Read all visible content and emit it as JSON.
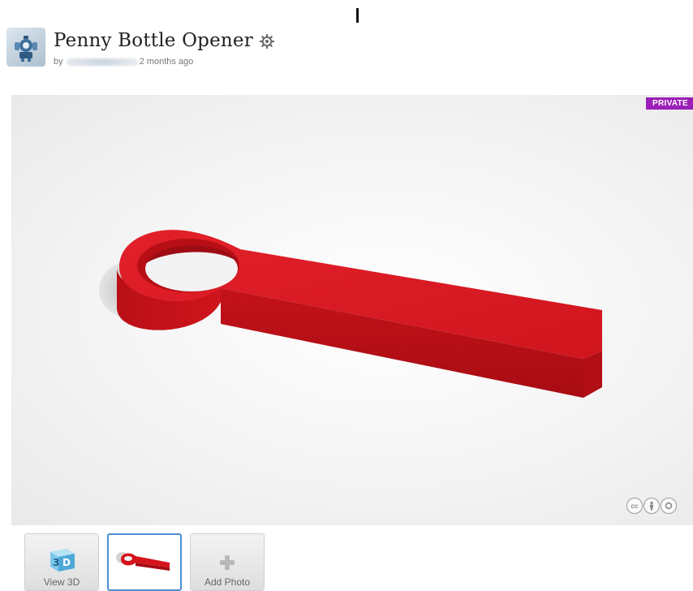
{
  "header": {
    "title": "Penny Bottle Opener",
    "by_prefix": "by",
    "time_ago": "2 months ago"
  },
  "icons": {
    "avatar": "robot-avatar-icon",
    "settings": "gear-icon",
    "license": [
      "creative-commons-icon",
      "attribution-icon",
      "no-derivatives-icon"
    ],
    "view3d": "3d-cube-icon",
    "add_photo": "plus-icon"
  },
  "viewer": {
    "badge": "PRIVATE",
    "license_labels": [
      "cc",
      "",
      ""
    ]
  },
  "thumbnails": [
    {
      "label": "View 3D"
    },
    {
      "label": ""
    },
    {
      "label": "Add Photo"
    }
  ],
  "colors": {
    "model_red": "#d4131b",
    "badge_purple": "#9b1fb8",
    "selected_border": "#4c8fd1"
  }
}
